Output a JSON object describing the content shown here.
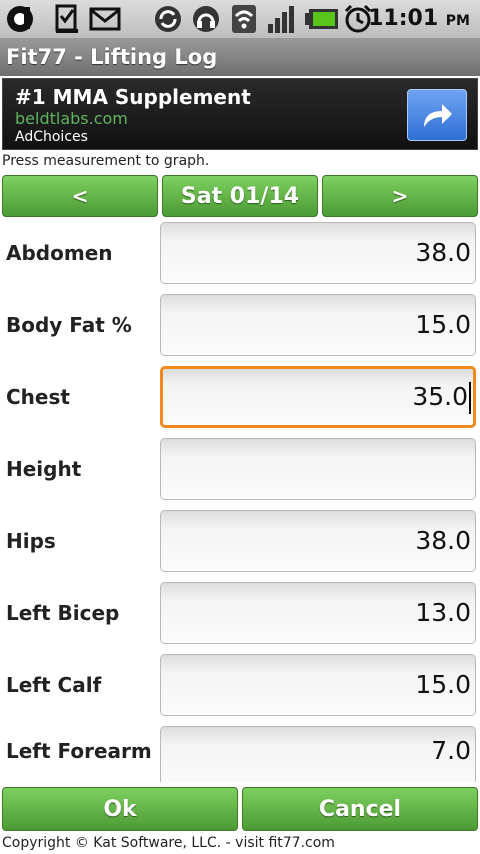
{
  "status_bar": {
    "time": "11:01",
    "ampm": "PM",
    "icons": [
      "d-app-icon",
      "clipboard-check-icon",
      "gmail-icon",
      "sync-icon",
      "headset-icon",
      "wifi-icon",
      "signal-icon",
      "battery-icon",
      "alarm-icon"
    ]
  },
  "app": {
    "title": "Fit77 - Lifting Log"
  },
  "ad": {
    "title": "#1 MMA Supplement",
    "url": "beldtlabs.com",
    "choices": "AdChoices"
  },
  "hint": "Press measurement to graph.",
  "nav": {
    "prev": "<",
    "date": "Sat 01/14",
    "next": ">"
  },
  "measurements": [
    {
      "label": "Abdomen",
      "value": "38.0"
    },
    {
      "label": "Body Fat %",
      "value": "15.0"
    },
    {
      "label": "Chest",
      "value": "35.0"
    },
    {
      "label": "Height",
      "value": ""
    },
    {
      "label": "Hips",
      "value": "38.0"
    },
    {
      "label": "Left Bicep",
      "value": "13.0"
    },
    {
      "label": "Left Calf",
      "value": "15.0"
    },
    {
      "label": "Left Forearm",
      "value": "7.0"
    }
  ],
  "buttons": {
    "ok": "Ok",
    "cancel": "Cancel"
  },
  "footer": "Copyright © Kat Software, LLC. - visit fit77.com",
  "colors": {
    "accent_green": "#5fb845",
    "focus_orange": "#f08a1c",
    "ad_url": "#5fb45f"
  }
}
